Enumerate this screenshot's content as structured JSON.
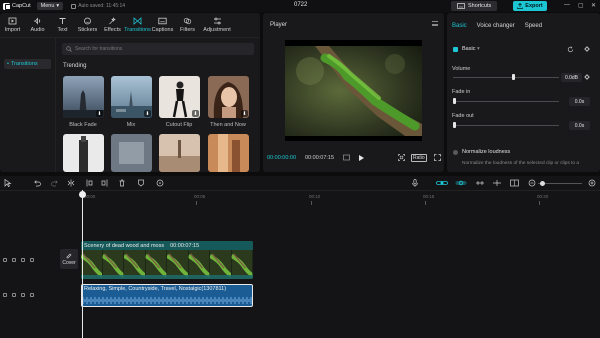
{
  "app": {
    "name": "CapCut",
    "menu_label": "Menu",
    "autosave": "Auto saved: 11:45:14",
    "project_title": "0722",
    "shortcuts_label": "Shortcuts",
    "export_label": "Export",
    "accent": "#1dc7d4"
  },
  "left_tabs": [
    {
      "label": "Import",
      "icon": "import-icon"
    },
    {
      "label": "Audio",
      "icon": "audio-icon"
    },
    {
      "label": "Text",
      "icon": "text-icon"
    },
    {
      "label": "Stickers",
      "icon": "stickers-icon"
    },
    {
      "label": "Effects",
      "icon": "effects-icon"
    },
    {
      "label": "Transitions",
      "icon": "transitions-icon",
      "active": true
    },
    {
      "label": "Captions",
      "icon": "captions-icon"
    },
    {
      "label": "Filters",
      "icon": "filters-icon"
    },
    {
      "label": "Adjustment",
      "icon": "adjustment-icon"
    }
  ],
  "sidebar": {
    "selected": "Transitions"
  },
  "search": {
    "placeholder": "Search for transitions"
  },
  "library": {
    "section": "Trending",
    "items": [
      {
        "label": "Black Fade"
      },
      {
        "label": "Mix"
      },
      {
        "label": "Cutout Flip"
      },
      {
        "label": "Then and Now"
      }
    ]
  },
  "player": {
    "title": "Player",
    "current_time": "00:00:00:00",
    "total_time": "00:00:07:15",
    "ratio_label": "Ratio"
  },
  "right_panel": {
    "tabs": [
      "Basic",
      "Voice changer",
      "Speed"
    ],
    "active_tab": "Basic",
    "section": "Basic",
    "volume_label": "Volume",
    "volume_value": "0.0dB",
    "fade_in_label": "Fade in",
    "fade_in_value": "0.0s",
    "fade_out_label": "Fade out",
    "fade_out_value": "0.0s",
    "normalize_label": "Normalize loudness",
    "normalize_desc": "Normalize the loudness of the selected clip or clips to a"
  },
  "timeline": {
    "ruler": [
      "00:00",
      "00:05",
      "00:10",
      "00:15",
      "00:20"
    ],
    "cover_label": "Cover",
    "video_clip": {
      "title": "Scenery of dead wood and moss",
      "duration": "00:00:07:15"
    },
    "audio_clip": {
      "title": "Relaxing, Simple, Countryside, Travel, Nostalgic(1307811)"
    }
  }
}
